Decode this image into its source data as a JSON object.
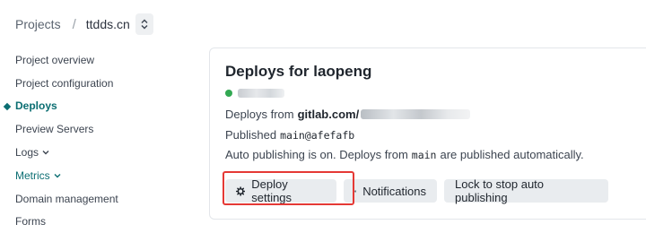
{
  "breadcrumb": {
    "projects": "Projects",
    "separator": "/",
    "site": "ttdds.cn",
    "switch_icon": "chevron-up-down-icon"
  },
  "sidebar": {
    "items": [
      {
        "label": "Project overview"
      },
      {
        "label": "Project configuration"
      },
      {
        "label": "Deploys",
        "active": true
      },
      {
        "label": "Preview Servers"
      },
      {
        "label": "Logs"
      },
      {
        "label": "Metrics"
      },
      {
        "label": "Domain management"
      },
      {
        "label": "Forms"
      }
    ]
  },
  "deploy_card": {
    "title": "Deploys for laopeng",
    "status_color": "#32a852",
    "deploys_from_prefix": "Deploys from",
    "repo_host": "gitlab.com/",
    "published_label": "Published",
    "published_ref": "main@afefafb",
    "auto_pub_part1": "Auto publishing is on. Deploys from",
    "auto_pub_branch": "main",
    "auto_pub_part2": "are published automatically."
  },
  "buttons": {
    "deploy_settings": "Deploy settings",
    "notifications": "Notifications",
    "lock": "Lock to stop auto publishing"
  },
  "colors": {
    "accent": "#0b6e72",
    "highlight": "#e53935",
    "button_bg": "#e9ecef"
  }
}
